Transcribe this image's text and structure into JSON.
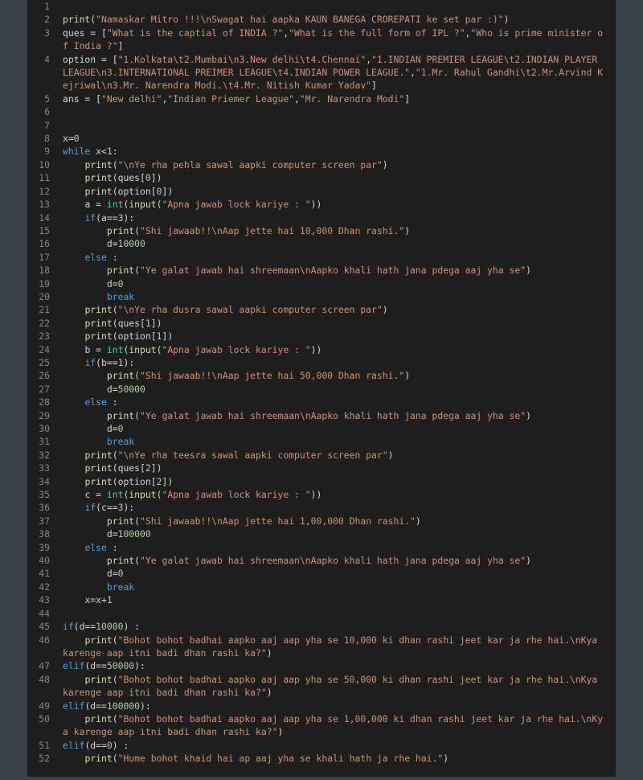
{
  "editor": {
    "lines": [
      [],
      [
        [
          "f",
          "print"
        ],
        [
          "p",
          "("
        ],
        [
          "s",
          "\"Namaskar Mitro !!!\\nSwagat hai aapka KAUN BANEGA CROREPATI ke set par :)\""
        ],
        [
          "p",
          ")"
        ]
      ],
      [
        [
          "p",
          "ques = ["
        ],
        [
          "s",
          "\"What is the captial of INDIA ?\""
        ],
        [
          "p",
          ","
        ],
        [
          "s",
          "\"What is the full form of IPL ?\""
        ],
        [
          "p",
          ","
        ],
        [
          "s",
          "\"Who is prime minister of India ?\""
        ],
        [
          "p",
          "]"
        ]
      ],
      [
        [
          "p",
          "option = ["
        ],
        [
          "s",
          "\"1.Kolkata\\t2.Mumbai\\n3.New delhi\\t4.Chennai\""
        ],
        [
          "p",
          ","
        ],
        [
          "s",
          "\"1.INDIAN PREMIER LEAGUE\\t2.INDIAN PLAYER LEAGUE\\n3.INTERNATIONAL PREIMER LEAGUE\\t4.INDIAN POWER LEAGUE.\""
        ],
        [
          "p",
          ","
        ],
        [
          "s",
          "\"1.Mr. Rahul Gandhi\\t2.Mr.Arvind Kejriwal\\n3.Mr. Narendra Modi.\\t4.Mr. Nitish Kumar Yadav\""
        ],
        [
          "p",
          "]"
        ]
      ],
      [
        [
          "p",
          "ans = ["
        ],
        [
          "s",
          "\"New delhi\""
        ],
        [
          "p",
          ","
        ],
        [
          "s",
          "\"Indian Priemer League\""
        ],
        [
          "p",
          ","
        ],
        [
          "s",
          "\"Mr. Narendra Modi\""
        ],
        [
          "p",
          "]"
        ]
      ],
      [],
      [],
      [
        [
          "p",
          "x="
        ],
        [
          "n",
          "0"
        ]
      ],
      [
        [
          "k",
          "while"
        ],
        [
          "p",
          " x<"
        ],
        [
          "n",
          "1"
        ],
        [
          "p",
          ":"
        ]
      ],
      [
        [
          "p",
          "    "
        ],
        [
          "f",
          "print"
        ],
        [
          "p",
          "("
        ],
        [
          "s",
          "\"\\nYe rha pehla sawal aapki computer screen par\""
        ],
        [
          "p",
          ")"
        ]
      ],
      [
        [
          "p",
          "    "
        ],
        [
          "f",
          "print"
        ],
        [
          "p",
          "(ques["
        ],
        [
          "n",
          "0"
        ],
        [
          "p",
          "])"
        ]
      ],
      [
        [
          "p",
          "    "
        ],
        [
          "f",
          "print"
        ],
        [
          "p",
          "(option["
        ],
        [
          "n",
          "0"
        ],
        [
          "p",
          "])"
        ]
      ],
      [
        [
          "p",
          "    a = "
        ],
        [
          "b",
          "int"
        ],
        [
          "p",
          "("
        ],
        [
          "f",
          "input"
        ],
        [
          "p",
          "("
        ],
        [
          "s",
          "\"Apna jawab lock kariye : \""
        ],
        [
          "p",
          "))"
        ]
      ],
      [
        [
          "p",
          "    "
        ],
        [
          "k",
          "if"
        ],
        [
          "p",
          "(a=="
        ],
        [
          "n",
          "3"
        ],
        [
          "p",
          "):"
        ]
      ],
      [
        [
          "p",
          "        "
        ],
        [
          "f",
          "print"
        ],
        [
          "p",
          "("
        ],
        [
          "s",
          "\"Shi jawaab!!\\nAap jette hai 10,000 Dhan rashi.\""
        ],
        [
          "p",
          ")"
        ]
      ],
      [
        [
          "p",
          "        d="
        ],
        [
          "n",
          "10000"
        ]
      ],
      [
        [
          "p",
          "    "
        ],
        [
          "k",
          "else"
        ],
        [
          "p",
          " :"
        ]
      ],
      [
        [
          "p",
          "        "
        ],
        [
          "f",
          "print"
        ],
        [
          "p",
          "("
        ],
        [
          "s",
          "\"Ye galat jawab hai shreemaan\\nAapko khali hath jana pdega aaj yha se\""
        ],
        [
          "p",
          ")"
        ]
      ],
      [
        [
          "p",
          "        d="
        ],
        [
          "n",
          "0"
        ]
      ],
      [
        [
          "p",
          "        "
        ],
        [
          "k",
          "break"
        ]
      ],
      [
        [
          "p",
          "    "
        ],
        [
          "f",
          "print"
        ],
        [
          "p",
          "("
        ],
        [
          "s",
          "\"\\nYe rha dusra sawal aapki computer screen par\""
        ],
        [
          "p",
          ")"
        ]
      ],
      [
        [
          "p",
          "    "
        ],
        [
          "f",
          "print"
        ],
        [
          "p",
          "(ques["
        ],
        [
          "n",
          "1"
        ],
        [
          "p",
          "])"
        ]
      ],
      [
        [
          "p",
          "    "
        ],
        [
          "f",
          "print"
        ],
        [
          "p",
          "(option["
        ],
        [
          "n",
          "1"
        ],
        [
          "p",
          "])"
        ]
      ],
      [
        [
          "p",
          "    b = "
        ],
        [
          "b",
          "int"
        ],
        [
          "p",
          "("
        ],
        [
          "f",
          "input"
        ],
        [
          "p",
          "("
        ],
        [
          "s",
          "\"Apna jawab lock kariye : \""
        ],
        [
          "p",
          "))"
        ]
      ],
      [
        [
          "p",
          "    "
        ],
        [
          "k",
          "if"
        ],
        [
          "p",
          "(b=="
        ],
        [
          "n",
          "1"
        ],
        [
          "p",
          "):"
        ]
      ],
      [
        [
          "p",
          "        "
        ],
        [
          "f",
          "print"
        ],
        [
          "p",
          "("
        ],
        [
          "s",
          "\"Shi jawaab!!\\nAap jette hai 50,000 Dhan rashi.\""
        ],
        [
          "p",
          ")"
        ]
      ],
      [
        [
          "p",
          "        d="
        ],
        [
          "n",
          "50000"
        ]
      ],
      [
        [
          "p",
          "    "
        ],
        [
          "k",
          "else"
        ],
        [
          "p",
          " :"
        ]
      ],
      [
        [
          "p",
          "        "
        ],
        [
          "f",
          "print"
        ],
        [
          "p",
          "("
        ],
        [
          "s",
          "\"Ye galat jawab hai shreemaan\\nAapko khali hath jana pdega aaj yha se\""
        ],
        [
          "p",
          ")"
        ]
      ],
      [
        [
          "p",
          "        d="
        ],
        [
          "n",
          "0"
        ]
      ],
      [
        [
          "p",
          "        "
        ],
        [
          "k",
          "break"
        ]
      ],
      [
        [
          "p",
          "    "
        ],
        [
          "f",
          "print"
        ],
        [
          "p",
          "("
        ],
        [
          "s",
          "\"\\nYe rha teesra sawal aapki computer screen par\""
        ],
        [
          "p",
          ")"
        ]
      ],
      [
        [
          "p",
          "    "
        ],
        [
          "f",
          "print"
        ],
        [
          "p",
          "(ques["
        ],
        [
          "n",
          "2"
        ],
        [
          "p",
          "])"
        ]
      ],
      [
        [
          "p",
          "    "
        ],
        [
          "f",
          "print"
        ],
        [
          "p",
          "(option["
        ],
        [
          "n",
          "2"
        ],
        [
          "p",
          "])"
        ]
      ],
      [
        [
          "p",
          "    c = "
        ],
        [
          "b",
          "int"
        ],
        [
          "p",
          "("
        ],
        [
          "f",
          "input"
        ],
        [
          "p",
          "("
        ],
        [
          "s",
          "\"Apna jawab lock kariye : \""
        ],
        [
          "p",
          "))"
        ]
      ],
      [
        [
          "p",
          "    "
        ],
        [
          "k",
          "if"
        ],
        [
          "p",
          "(c=="
        ],
        [
          "n",
          "3"
        ],
        [
          "p",
          "):"
        ]
      ],
      [
        [
          "p",
          "        "
        ],
        [
          "f",
          "print"
        ],
        [
          "p",
          "("
        ],
        [
          "s",
          "\"Shi jawaab!!\\nAap jette hai 1,00,000 Dhan rashi.\""
        ],
        [
          "p",
          ")"
        ]
      ],
      [
        [
          "p",
          "        d="
        ],
        [
          "n",
          "100000"
        ]
      ],
      [
        [
          "p",
          "    "
        ],
        [
          "k",
          "else"
        ],
        [
          "p",
          " :"
        ]
      ],
      [
        [
          "p",
          "        "
        ],
        [
          "f",
          "print"
        ],
        [
          "p",
          "("
        ],
        [
          "s",
          "\"Ye galat jawab hai shreemaan\\nAapko khali hath jana pdega aaj yha se\""
        ],
        [
          "p",
          ")"
        ]
      ],
      [
        [
          "p",
          "        d="
        ],
        [
          "n",
          "0"
        ]
      ],
      [
        [
          "p",
          "        "
        ],
        [
          "k",
          "break"
        ]
      ],
      [
        [
          "p",
          "    x=x+"
        ],
        [
          "n",
          "1"
        ]
      ],
      [],
      [
        [
          "k",
          "if"
        ],
        [
          "p",
          "(d=="
        ],
        [
          "n",
          "10000"
        ],
        [
          "p",
          ") :"
        ]
      ],
      [
        [
          "p",
          "    "
        ],
        [
          "f",
          "print"
        ],
        [
          "p",
          "("
        ],
        [
          "s",
          "\"Bohot bohot badhai aapko aaj aap yha se 10,000 ki dhan rashi jeet kar ja rhe hai.\\nKya karenge aap itni badi dhan rashi ka?\""
        ],
        [
          "p",
          ")"
        ]
      ],
      [
        [
          "k",
          "elif"
        ],
        [
          "p",
          "(d=="
        ],
        [
          "n",
          "50000"
        ],
        [
          "p",
          "):"
        ]
      ],
      [
        [
          "p",
          "    "
        ],
        [
          "f",
          "print"
        ],
        [
          "p",
          "("
        ],
        [
          "s",
          "\"Bohot bohot badhai aapko aaj aap yha se 50,000 ki dhan rashi jeet kar ja rhe hai.\\nKya karenge aap itni badi dhan rashi ka?\""
        ],
        [
          "p",
          ")"
        ]
      ],
      [
        [
          "k",
          "elif"
        ],
        [
          "p",
          "(d=="
        ],
        [
          "n",
          "100000"
        ],
        [
          "p",
          "):"
        ]
      ],
      [
        [
          "p",
          "    "
        ],
        [
          "f",
          "print"
        ],
        [
          "p",
          "("
        ],
        [
          "s",
          "\"Bohot bohot badhai aapko aaj aap yha se 1,00,000 ki dhan rashi jeet kar ja rhe hai.\\nKya karenge aap itni badi dhan rashi ka?\""
        ],
        [
          "p",
          ")"
        ]
      ],
      [
        [
          "k",
          "elif"
        ],
        [
          "p",
          "(d=="
        ],
        [
          "n",
          "0"
        ],
        [
          "p",
          ") :"
        ]
      ],
      [
        [
          "p",
          "    "
        ],
        [
          "f",
          "print"
        ],
        [
          "p",
          "("
        ],
        [
          "s",
          "\"Hume bohot khaid hai ap aaj yha se khali hath ja rhe hai.\""
        ],
        [
          "p",
          ")"
        ]
      ]
    ]
  },
  "colors": {
    "background": "#3b4148",
    "editor_bg": "#1e1e1e",
    "keyword": "#569cd6",
    "function": "#dcdcaa",
    "builtin": "#4ec9b0",
    "string": "#ce9178",
    "number": "#b5cea8",
    "text": "#d4d4d4",
    "line_number": "#858585"
  }
}
